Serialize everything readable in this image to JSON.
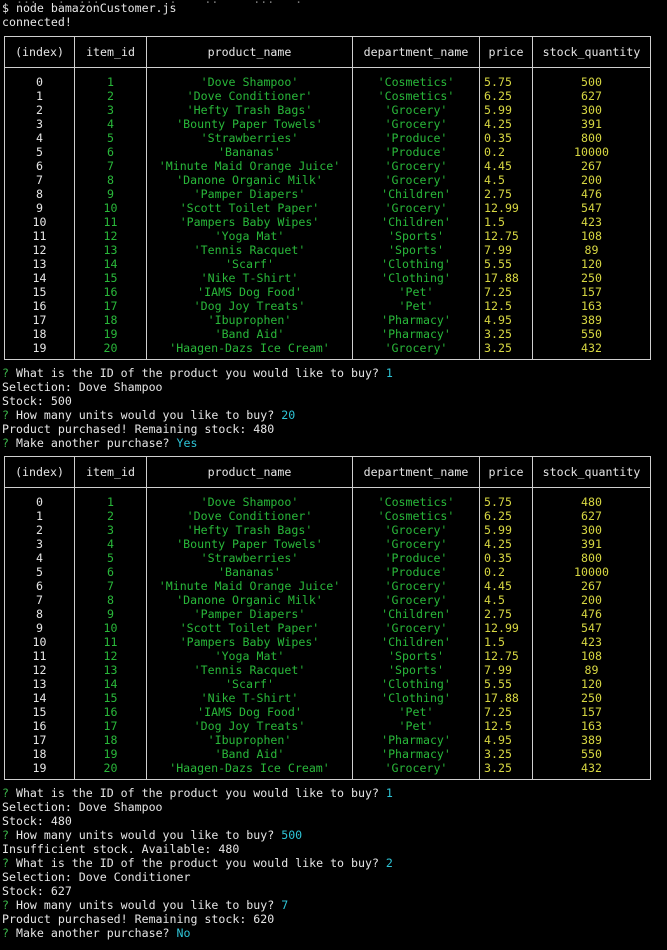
{
  "top_line_partial": "  ...   .  ...          .    ..     ...   .",
  "prompt_line": "$ node bamazonCustomer.js",
  "connected": "connected!",
  "columns": [
    "(index)",
    "item_id",
    "product_name",
    "department_name",
    "price",
    "stock_quantity"
  ],
  "table1": [
    [
      "0",
      "1",
      "'Dove Shampoo'",
      "'Cosmetics'",
      "5.75",
      "500"
    ],
    [
      "1",
      "2",
      "'Dove Conditioner'",
      "'Cosmetics'",
      "6.25",
      "627"
    ],
    [
      "2",
      "3",
      "'Hefty Trash Bags'",
      "'Grocery'",
      "5.99",
      "300"
    ],
    [
      "3",
      "4",
      "'Bounty Paper Towels'",
      "'Grocery'",
      "4.25",
      "391"
    ],
    [
      "4",
      "5",
      "'Strawberries'",
      "'Produce'",
      "0.35",
      "800"
    ],
    [
      "5",
      "6",
      "'Bananas'",
      "'Produce'",
      "0.2",
      "10000"
    ],
    [
      "6",
      "7",
      "'Minute Maid Orange Juice'",
      "'Grocery'",
      "4.45",
      "267"
    ],
    [
      "7",
      "8",
      "'Danone Organic Milk'",
      "'Grocery'",
      "4.5",
      "200"
    ],
    [
      "8",
      "9",
      "'Pamper Diapers'",
      "'Children'",
      "2.75",
      "476"
    ],
    [
      "9",
      "10",
      "'Scott Toilet Paper'",
      "'Grocery'",
      "12.99",
      "547"
    ],
    [
      "10",
      "11",
      "'Pampers Baby Wipes'",
      "'Children'",
      "1.5",
      "423"
    ],
    [
      "11",
      "12",
      "'Yoga Mat'",
      "'Sports'",
      "12.75",
      "108"
    ],
    [
      "12",
      "13",
      "'Tennis Racquet'",
      "'Sports'",
      "7.99",
      "89"
    ],
    [
      "13",
      "14",
      "'Scarf'",
      "'Clothing'",
      "5.55",
      "120"
    ],
    [
      "14",
      "15",
      "'Nike T-Shirt'",
      "'Clothing'",
      "17.88",
      "250"
    ],
    [
      "15",
      "16",
      "'IAMS Dog Food'",
      "'Pet'",
      "7.25",
      "157"
    ],
    [
      "16",
      "17",
      "'Dog Joy Treats'",
      "'Pet'",
      "12.5",
      "163"
    ],
    [
      "17",
      "18",
      "'Ibuprophen'",
      "'Pharmacy'",
      "4.95",
      "389"
    ],
    [
      "18",
      "19",
      "'Band Aid'",
      "'Pharmacy'",
      "3.25",
      "550"
    ],
    [
      "19",
      "20",
      "'Haagen-Dazs Ice Cream'",
      "'Grocery'",
      "3.25",
      "432"
    ]
  ],
  "table2": [
    [
      "0",
      "1",
      "'Dove Shampoo'",
      "'Cosmetics'",
      "5.75",
      "480"
    ],
    [
      "1",
      "2",
      "'Dove Conditioner'",
      "'Cosmetics'",
      "6.25",
      "627"
    ],
    [
      "2",
      "3",
      "'Hefty Trash Bags'",
      "'Grocery'",
      "5.99",
      "300"
    ],
    [
      "3",
      "4",
      "'Bounty Paper Towels'",
      "'Grocery'",
      "4.25",
      "391"
    ],
    [
      "4",
      "5",
      "'Strawberries'",
      "'Produce'",
      "0.35",
      "800"
    ],
    [
      "5",
      "6",
      "'Bananas'",
      "'Produce'",
      "0.2",
      "10000"
    ],
    [
      "6",
      "7",
      "'Minute Maid Orange Juice'",
      "'Grocery'",
      "4.45",
      "267"
    ],
    [
      "7",
      "8",
      "'Danone Organic Milk'",
      "'Grocery'",
      "4.5",
      "200"
    ],
    [
      "8",
      "9",
      "'Pamper Diapers'",
      "'Children'",
      "2.75",
      "476"
    ],
    [
      "9",
      "10",
      "'Scott Toilet Paper'",
      "'Grocery'",
      "12.99",
      "547"
    ],
    [
      "10",
      "11",
      "'Pampers Baby Wipes'",
      "'Children'",
      "1.5",
      "423"
    ],
    [
      "11",
      "12",
      "'Yoga Mat'",
      "'Sports'",
      "12.75",
      "108"
    ],
    [
      "12",
      "13",
      "'Tennis Racquet'",
      "'Sports'",
      "7.99",
      "89"
    ],
    [
      "13",
      "14",
      "'Scarf'",
      "'Clothing'",
      "5.55",
      "120"
    ],
    [
      "14",
      "15",
      "'Nike T-Shirt'",
      "'Clothing'",
      "17.88",
      "250"
    ],
    [
      "15",
      "16",
      "'IAMS Dog Food'",
      "'Pet'",
      "7.25",
      "157"
    ],
    [
      "16",
      "17",
      "'Dog Joy Treats'",
      "'Pet'",
      "12.5",
      "163"
    ],
    [
      "17",
      "18",
      "'Ibuprophen'",
      "'Pharmacy'",
      "4.95",
      "389"
    ],
    [
      "18",
      "19",
      "'Band Aid'",
      "'Pharmacy'",
      "3.25",
      "550"
    ],
    [
      "19",
      "20",
      "'Haagen-Dazs Ice Cream'",
      "'Grocery'",
      "3.25",
      "432"
    ]
  ],
  "session1": {
    "q_id": "What is the ID of the product you would like to buy?",
    "a_id": "1",
    "selection": "Selection: Dove Shampoo",
    "stock": "Stock: 500",
    "q_units": "How many units would you like to buy?",
    "a_units": "20",
    "result": "Product purchased! Remaining stock: 480",
    "q_again": "Make another purchase?",
    "a_again": "Yes"
  },
  "session2": {
    "q_id": "What is the ID of the product you would like to buy?",
    "a_id": "1",
    "selection": "Selection: Dove Shampoo",
    "stock": "Stock: 480",
    "q_units": "How many units would you like to buy?",
    "a_units": "500",
    "result": "Insufficient stock. Available: 480",
    "q_id2": "What is the ID of the product you would like to buy?",
    "a_id2": "2",
    "selection2": "Selection: Dove Conditioner",
    "stock2": "Stock: 627",
    "q_units2": "How many units would you like to buy?",
    "a_units2": "7",
    "result2": "Product purchased! Remaining stock: 620",
    "q_again2": "Make another purchase?",
    "a_again2": "No"
  },
  "prompt_mark": "?",
  "colors": {
    "background": "#000000",
    "text": "#e6e6e6",
    "question_mark": "#3bb44a",
    "answer": "#2ec4d6",
    "string_value": "#29b83a",
    "number_value": "#d7d742"
  }
}
